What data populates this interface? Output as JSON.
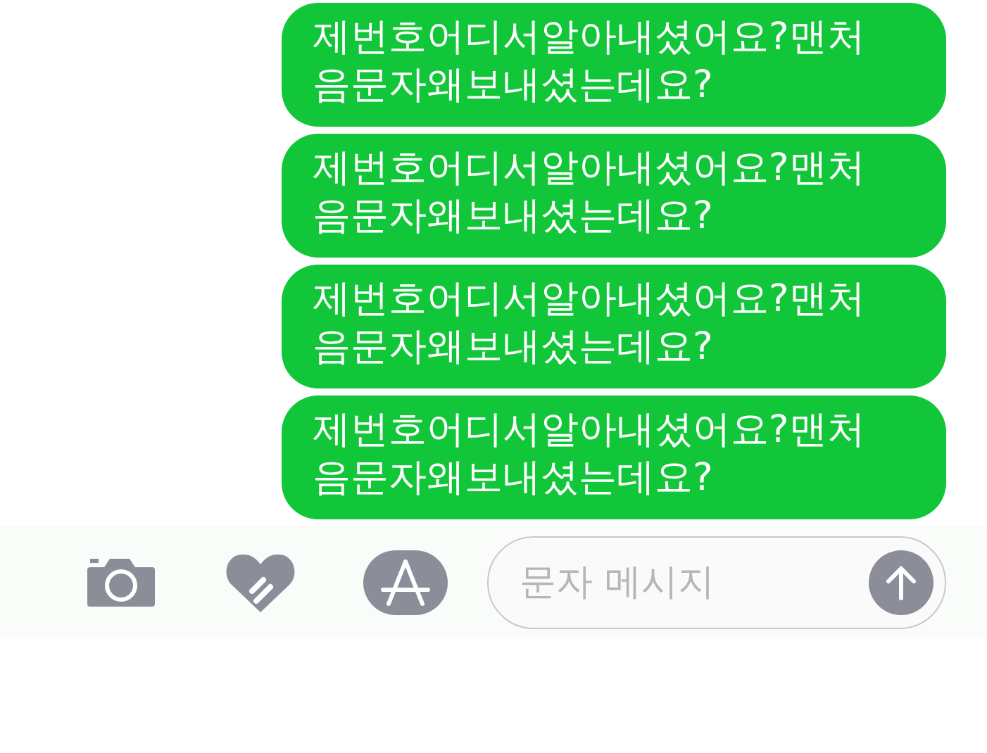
{
  "messages": [
    {
      "text": "제번호어디서알아내셨어요?맨처음문자왜보내셨는데요?",
      "kind": "sent"
    },
    {
      "text": "제번호어디서알아내셨어요?맨처음문자왜보내셨는데요?",
      "kind": "sent"
    },
    {
      "text": "제번호어디서알아내셨어요?맨처음문자왜보내셨는데요?",
      "kind": "sent"
    },
    {
      "text": "제번호어디서알아내셨어요?맨처음문자왜보내셨는데요?",
      "kind": "sent"
    }
  ],
  "composer": {
    "placeholder": "문자 메시지"
  }
}
